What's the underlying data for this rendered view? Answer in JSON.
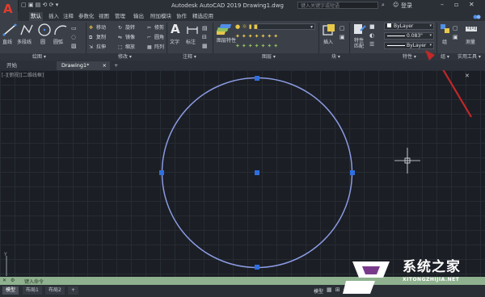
{
  "app": {
    "title": "Autodesk AutoCAD 2019    Drawing1.dwg",
    "search_placeholder": "键入关键字或短语",
    "login": "登录"
  },
  "ribbon_tabs": [
    "默认",
    "插入",
    "注释",
    "参数化",
    "视图",
    "管理",
    "输出",
    "附加模块",
    "协作",
    "精选应用"
  ],
  "ribbon_tools": {
    "draw": [
      "直线",
      "多段线",
      "圆",
      "圆弧"
    ],
    "modify": [
      "移动",
      "旋转",
      "修剪",
      "复制",
      "镜像",
      "圆角",
      "拉伸",
      "缩放",
      "阵列"
    ],
    "annotation": [
      "文字",
      "标注"
    ],
    "layers": [
      "图层特性"
    ],
    "block": [
      "插入"
    ],
    "properties": [
      "特性匹配"
    ],
    "utilities": [
      "组",
      "测量"
    ]
  },
  "panel_labels": [
    "绘图 ▾",
    "修改 ▾",
    "注释 ▾",
    "图层 ▾",
    "块 ▾",
    "特性 ▾",
    "组 ▾",
    "实用工具 ▾"
  ],
  "properties": {
    "color": "ByLayer",
    "lineweight": "0.083\"",
    "linetype": "ByLayer"
  },
  "doc_tabs": [
    "开始",
    "Drawing1*",
    "+"
  ],
  "command_prompt": "键入命令",
  "layout_tabs": [
    "模型",
    "布局1",
    "布局2",
    "+"
  ],
  "status_model": "模型",
  "watermark": {
    "text": "系统之家",
    "url": "XITONGZHIJIA.NET"
  },
  "colors": {
    "circle": "#8a9be3",
    "grip": "#2e6fe0",
    "arrow": "#c0282a",
    "command_bg": "#8fb18f"
  }
}
